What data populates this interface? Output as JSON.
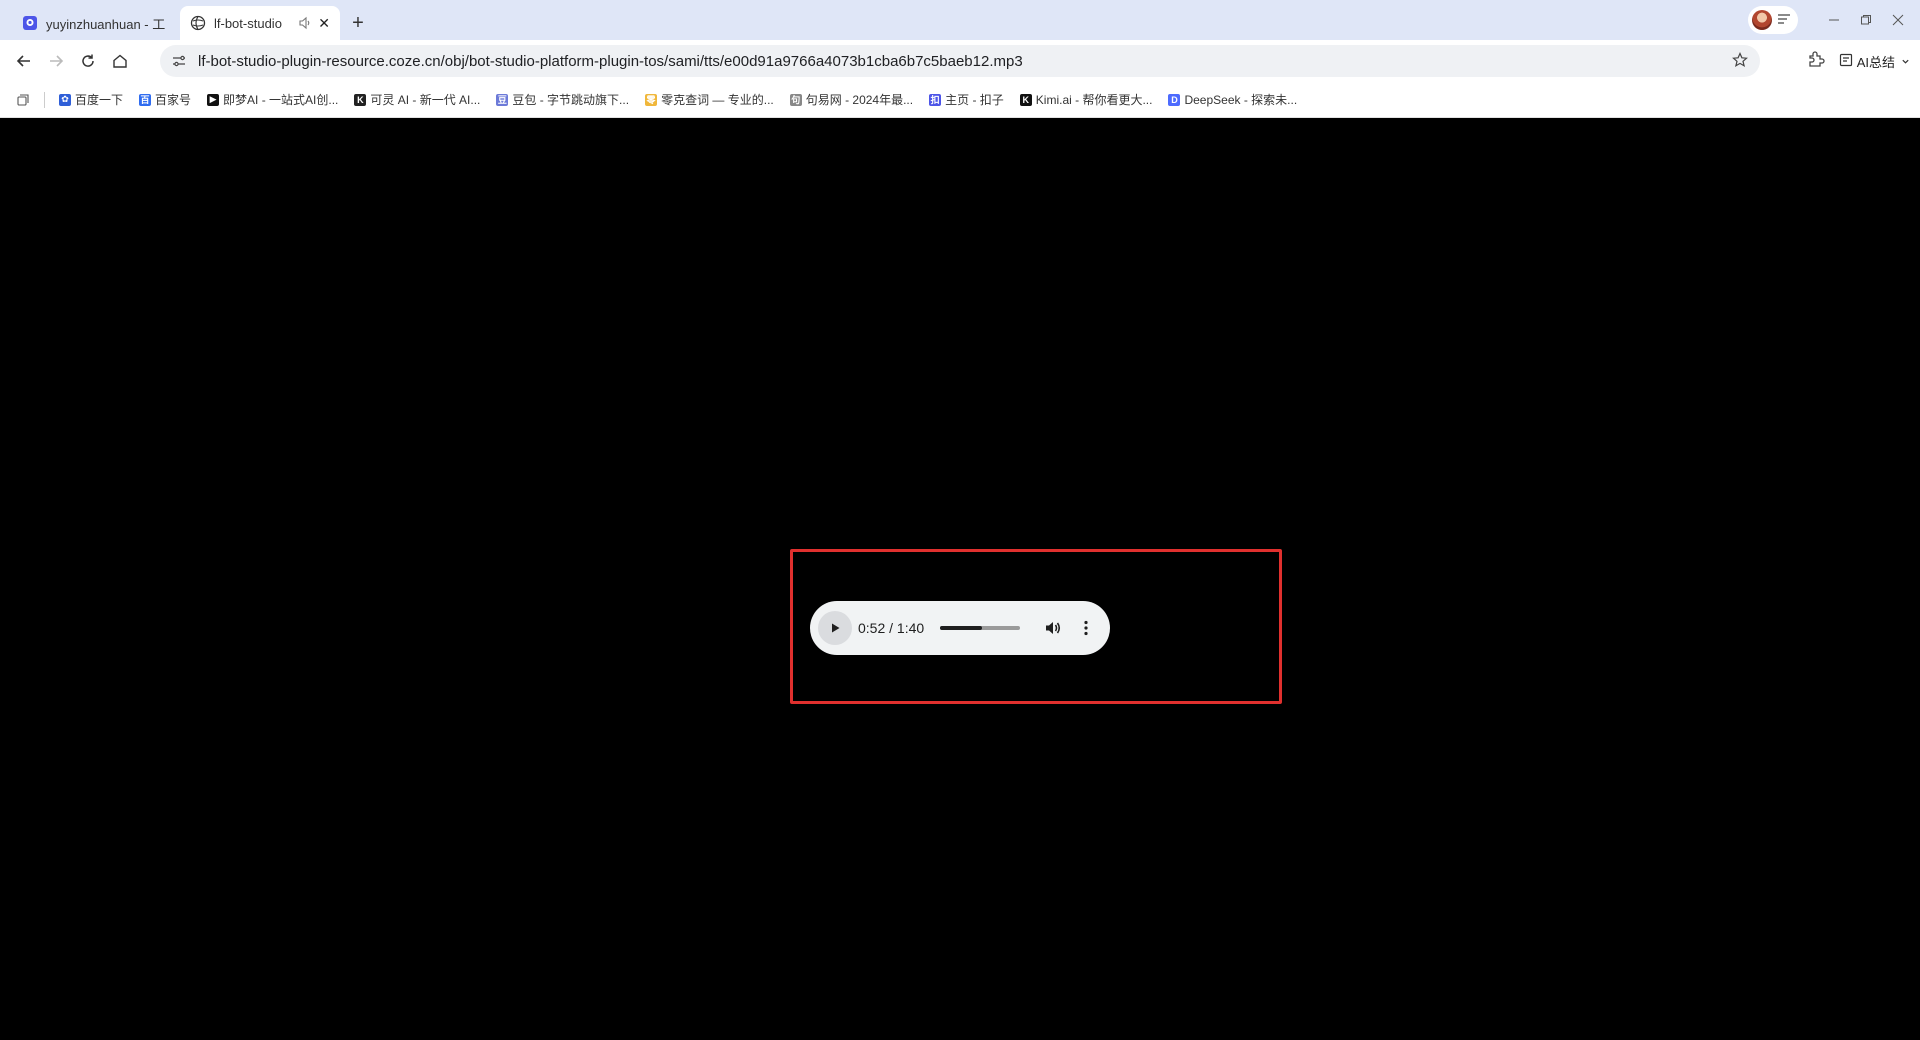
{
  "tabs": [
    {
      "title": "yuyinzhuanhuan - 工",
      "active": false,
      "icon": "coze-icon"
    },
    {
      "title": "lf-bot-studio",
      "active": true,
      "icon": "globe-icon",
      "extra": "speaker-muted-icon"
    }
  ],
  "address_bar": {
    "url": "lf-bot-studio-plugin-resource.coze.cn/obj/bot-studio-platform-plugin-tos/sami/tts/e00d91a9766a4073b1cba6b7c5baeb12.mp3"
  },
  "toolbar": {
    "ai_summary_label": "AI总结"
  },
  "bookmarks": [
    {
      "label": "百度一下",
      "icon_color": "#2f5fd8",
      "glyph": "✿"
    },
    {
      "label": "百家号",
      "icon_color": "#2f6cf0",
      "glyph": "百"
    },
    {
      "label": "即梦AI - 一站式AI创...",
      "icon_color": "#111111",
      "glyph": "▶"
    },
    {
      "label": "可灵 AI - 新一代 AI...",
      "icon_color": "#222222",
      "glyph": "K"
    },
    {
      "label": "豆包 - 字节跳动旗下...",
      "icon_color": "#6c7ad8",
      "glyph": "豆"
    },
    {
      "label": "零克查词 — 专业的...",
      "icon_color": "#f0b73a",
      "glyph": "零"
    },
    {
      "label": "句易网 - 2024年最...",
      "icon_color": "#888888",
      "glyph": "句"
    },
    {
      "label": "主页 - 扣子",
      "icon_color": "#4d55e8",
      "glyph": "扣"
    },
    {
      "label": "Kimi.ai - 帮你看更大...",
      "icon_color": "#111111",
      "glyph": "K"
    },
    {
      "label": "DeepSeek - 探索未...",
      "icon_color": "#4d6bfe",
      "glyph": "D"
    }
  ],
  "audio_player": {
    "time": "0:52 / 1:40",
    "progress_fraction": 0.52
  },
  "colors": {
    "highlight_border": "#e0302e",
    "tab_bar_bg": "#dfe6f7",
    "page_bg": "#000000"
  }
}
